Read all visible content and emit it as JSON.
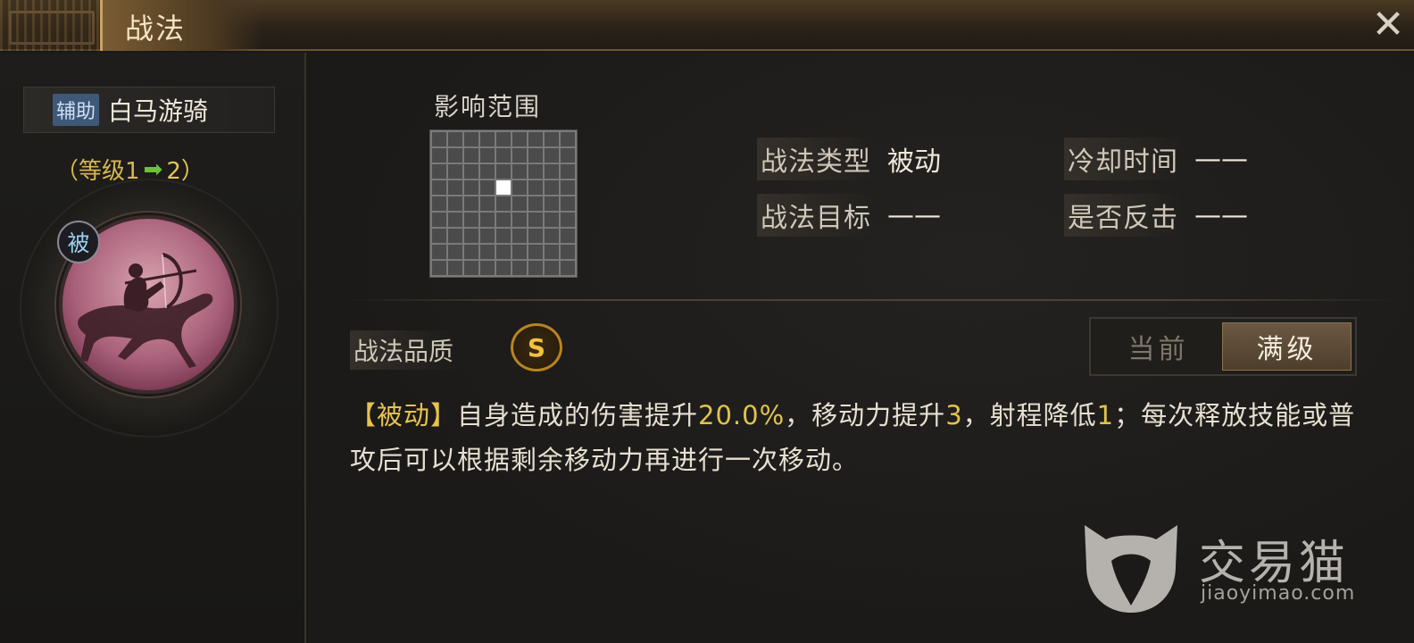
{
  "header": {
    "title": "战法"
  },
  "skill": {
    "role_badge": "辅助",
    "name": "白马游骑",
    "level_prefix": "（等级1",
    "level_next": "2）",
    "passive_badge": "被"
  },
  "range": {
    "label": "影响范围",
    "grid_size": 9,
    "target_cell": {
      "row": 3,
      "col": 4
    }
  },
  "info": {
    "type_label": "战法类型",
    "type_value": "被动",
    "cooldown_label": "冷却时间",
    "cooldown_value": "——",
    "target_label": "战法目标",
    "target_value": "——",
    "counter_label": "是否反击",
    "counter_value": "——"
  },
  "quality": {
    "label": "战法品质",
    "grade": "S"
  },
  "toggle": {
    "current": "当前",
    "max": "满级",
    "selected": "max"
  },
  "description": {
    "tag": "【被动】",
    "p1": "自身造成的伤害提升",
    "v1": "20.0%",
    "p2": "，移动力提升",
    "v2": "3",
    "p3": "，射程降低",
    "v3": "1",
    "p4": "；每次释放技能或普攻后可以根据剩余移动力再进行一次移动。"
  },
  "watermark": {
    "name": "交易猫",
    "url": "jiaoyimao.com"
  },
  "colors": {
    "highlight": "#e2c24b",
    "level_arrow": "#6cc23a",
    "role_badge_bg": "#3f5878"
  }
}
